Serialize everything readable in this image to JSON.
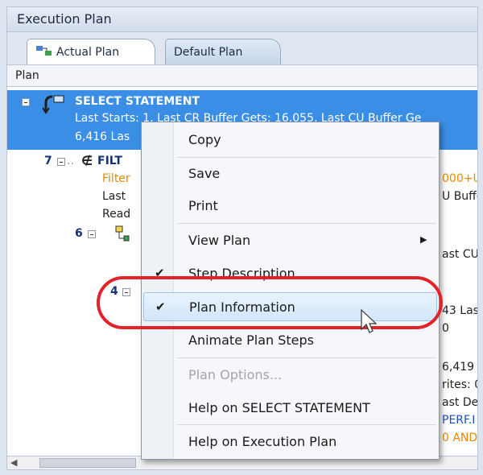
{
  "window": {
    "title": "Execution Plan"
  },
  "tabs": [
    {
      "label": "Actual Plan",
      "icon": "plan-graph-icon"
    },
    {
      "label": "Default Plan"
    }
  ],
  "panel_label": "Plan",
  "tree": {
    "root": {
      "label": "SELECT STATEMENT",
      "line2": "Last Starts: 1, Last CR Buffer Gets: 16,055, Last CU Buffer Ge",
      "line3": "6,416 Las"
    },
    "rows": [
      {
        "num": "7",
        "label": "FILT",
        "filter": "Filter",
        "filter_right": "000+U",
        "line2": "Last",
        "line2_right": "U Buffe",
        "line3": "Read"
      },
      {
        "num": "6",
        "right": "ast CU"
      },
      {
        "num": "4",
        "right1": "43 Las",
        "right2": "0"
      }
    ],
    "right_fragments": [
      "6,419",
      "rites: 0",
      "ast De",
      "PERF.I",
      "0 AND"
    ]
  },
  "context_menu": {
    "items": [
      {
        "label": "Copy"
      },
      {
        "label": "Save"
      },
      {
        "label": "Print"
      },
      {
        "label": "View Plan",
        "submenu": true
      },
      {
        "label": "Step Description",
        "checked": true
      },
      {
        "label": "Plan Information",
        "checked": true,
        "highlighted": true
      },
      {
        "label": "Animate Plan Steps"
      },
      {
        "label": "Plan Options...",
        "disabled": true
      },
      {
        "label": "Help on SELECT STATEMENT"
      },
      {
        "label": "Help on Execution Plan"
      }
    ]
  },
  "colors": {
    "selection": "#3a8ee6",
    "annotation": "#e0242a",
    "filter_text": "#e48a00"
  }
}
